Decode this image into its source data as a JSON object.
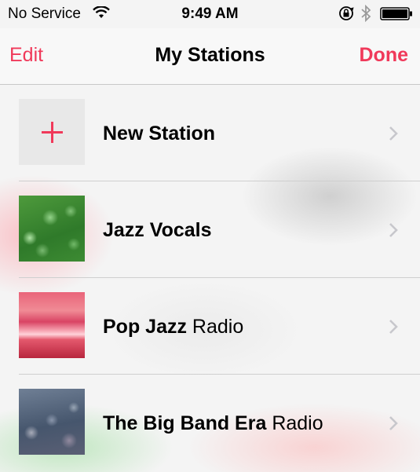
{
  "status_bar": {
    "carrier": "No Service",
    "time": "9:49 AM",
    "icons": [
      "wifi-icon",
      "rotation-lock-icon",
      "bluetooth-icon",
      "battery-icon"
    ]
  },
  "nav": {
    "edit_label": "Edit",
    "title": "My Stations",
    "done_label": "Done"
  },
  "stations": [
    {
      "bold": "New Station",
      "rest": "",
      "thumbnail": "plus-icon"
    },
    {
      "bold": "Jazz Vocals",
      "rest": "",
      "thumbnail": "green-bokeh-artwork"
    },
    {
      "bold": "Pop Jazz",
      "rest": " Radio",
      "thumbnail": "pink-sunset-artwork"
    },
    {
      "bold": "The Big Band Era",
      "rest": " Radio",
      "thumbnail": "gray-rain-artwork"
    }
  ],
  "colors": {
    "accent": "#f0395a",
    "chevron": "#c7c7cc",
    "separator": "#cfcfcf"
  }
}
